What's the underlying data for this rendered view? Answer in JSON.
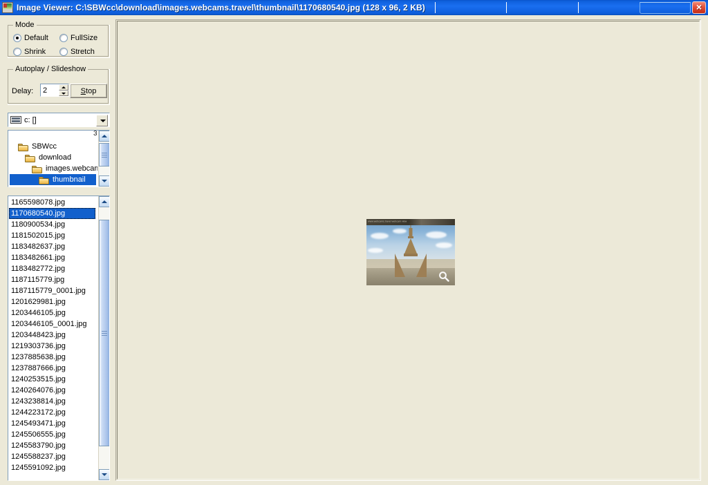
{
  "window": {
    "app_name": "Image Viewer",
    "title": "Image Viewer: C:\\SBWcc\\download\\images.webcams.travel\\thumbnail\\1170680540.jpg (128 x 96, 2 KB)",
    "close_label": "×",
    "accent_color": "#1a6ff0",
    "close_color": "#c32b15",
    "selection_color": "#1260cc",
    "face_color": "#ece9d8"
  },
  "mode": {
    "group_label": "Mode",
    "options": [
      {
        "label": "Default",
        "selected": true
      },
      {
        "label": "FullSize",
        "selected": false
      },
      {
        "label": "Shrink",
        "selected": false
      },
      {
        "label": "Stretch",
        "selected": false
      }
    ]
  },
  "autoplay": {
    "group_label": "Autoplay / Slideshow",
    "delay_label": "Delay:",
    "delay_value": "2",
    "delay_placeholder": "2",
    "stop_button": "Stop",
    "stop_accel": "S"
  },
  "drive": {
    "selected": "c: []",
    "icon": "drive-icon"
  },
  "tree": {
    "partial_top_item": "3",
    "items": [
      {
        "label": "SBWcc",
        "depth": 0,
        "selected": false
      },
      {
        "label": "download",
        "depth": 1,
        "selected": false
      },
      {
        "label": "images.webcams.tra",
        "depth": 2,
        "selected": false
      },
      {
        "label": "thumbnail",
        "depth": 3,
        "selected": true
      }
    ]
  },
  "files": {
    "selected": "1170680540.jpg",
    "items": [
      "1165598078.jpg",
      "1170680540.jpg",
      "1180900534.jpg",
      "1181502015.jpg",
      "1183482637.jpg",
      "1183482661.jpg",
      "1183482772.jpg",
      "1187115779.jpg",
      "1187115779_0001.jpg",
      "1201629981.jpg",
      "1203446105.jpg",
      "1203446105_0001.jpg",
      "1203448423.jpg",
      "1219303736.jpg",
      "1237885638.jpg",
      "1237887666.jpg",
      "1240253515.jpg",
      "1240264076.jpg",
      "1243238814.jpg",
      "1244223172.jpg",
      "1245493471.jpg",
      "1245506555.jpg",
      "1245583790.jpg",
      "1245588237.jpg",
      "1245591092.jpg"
    ]
  },
  "viewer": {
    "image_caption_bar": "www.webcams.travel       webcam view",
    "image_subject": "Eiffel Tower, Paris",
    "magnifier": "magnifier-icon",
    "image_width": "128",
    "image_height": "96"
  }
}
